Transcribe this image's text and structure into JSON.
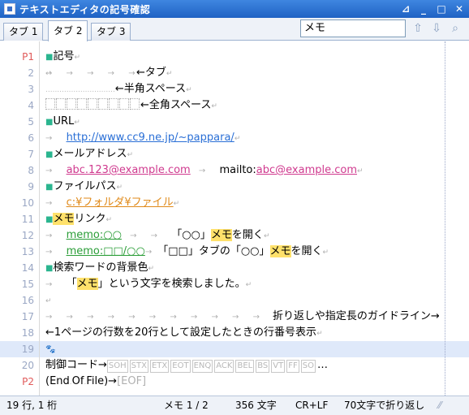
{
  "window": {
    "title": "テキストエディタの記号確認"
  },
  "tabs": [
    "タブ 1",
    "タブ 2",
    "タブ 3"
  ],
  "search": {
    "value": "メモ"
  },
  "lines": {
    "l1": "P1",
    "l2": "2",
    "l3": "3",
    "l4": "4",
    "l5": "5",
    "l6": "6",
    "l7": "7",
    "l8": "8",
    "l9": "9",
    "l10": "10",
    "l11": "11",
    "l12": "12",
    "l13": "13",
    "l14": "14",
    "l15": "15",
    "l16": "16",
    "l17": "17",
    "l18": "18",
    "l19": "19",
    "l20": "20",
    "l21": "P2"
  },
  "text": {
    "t1": "記号",
    "t3": "←タブ",
    "t4": "←半角スペース",
    "t5": "←全角スペース",
    "t6": "URL",
    "t7": "http://www.cc9.ne.jp/~pappara/",
    "t8": "メールアドレス",
    "t9a": "abc.123@example.com",
    "t9b": "mailto:",
    "t9c": "abc@example.com",
    "t10": "ファイルパス",
    "t11": "c:¥フォルダ¥ファイル",
    "t12a": "メモ",
    "t12b": "リンク",
    "t13a": "memo:○○",
    "t13b": "「○○」",
    "t13c": "メモ",
    "t13d": "を開く",
    "t14a": "memo:□□/○○",
    "t14b": "「□□」タブの「○○」",
    "t14c": "メモ",
    "t14d": "を開く",
    "t15": "検索ワードの背景色",
    "t16a": "「",
    "t16b": "メモ",
    "t16c": "」という文字を検索しました。",
    "t18": "折り返しや指定長のガイドライン→",
    "t19": "←1ページの行数を20行として設定したときの行番号表示",
    "t21a": "制御コード→",
    "ctrl": [
      "SOH",
      "STX",
      "ETX",
      "EOT",
      "ENQ",
      "ACK",
      "BEL",
      "BS",
      "VT",
      "FF",
      "SO"
    ],
    "t21b": "…",
    "t22a": "(End",
    "t22b": "Of",
    "t22c": "File)→",
    "t22d": "[EOF]"
  },
  "status": {
    "position": "19 行, 1 桁",
    "match": "メモ 1 / 2",
    "chars": "356 文字",
    "eol": "CR+LF",
    "wrap": "70文字で折り返し"
  }
}
